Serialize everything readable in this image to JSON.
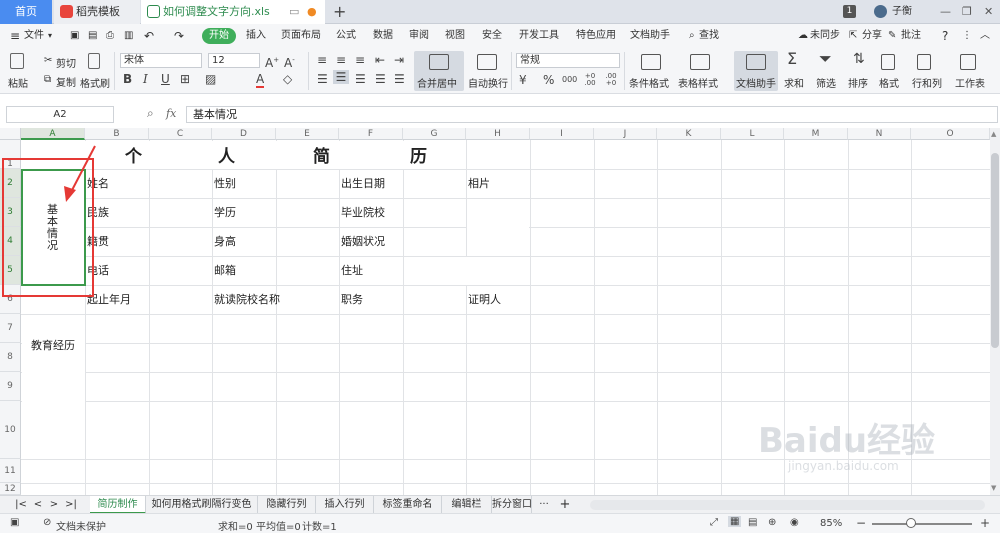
{
  "tabs": {
    "home": "首页",
    "wps": "稻壳模板",
    "file": "如何调整文字方向.xls",
    "new_tab": "+",
    "tab_count": "1",
    "user": "子衡"
  },
  "menu": {
    "file": "文件",
    "start": "开始",
    "items": [
      "插入",
      "页面布局",
      "公式",
      "数据",
      "审阅",
      "视图",
      "安全",
      "开发工具",
      "特色应用",
      "文档助手"
    ],
    "search": "查找",
    "sync": "未同步",
    "share": "分享",
    "comment": "批注"
  },
  "ribbon": {
    "paste": "粘贴",
    "cut": "剪切",
    "copy": "复制",
    "format_painter": "格式刷",
    "font_name": "宋体",
    "font_size": "12",
    "merge": "合并居中",
    "wrap": "自动换行",
    "number_format": "常规",
    "cond_format": "条件格式",
    "table_style": "表格样式",
    "doc_assist": "文档助手",
    "sum": "求和",
    "filter": "筛选",
    "sort": "排序",
    "format": "格式",
    "row_col": "行和列",
    "worksheet": "工作表",
    "bold": "B",
    "italic": "I",
    "underline": "U",
    "currency": "¥",
    "percent": "%",
    "thousands": "000",
    "dec_inc": "+0 .00",
    "dec_dec": ".00 +0"
  },
  "formula_bar": {
    "name_box": "A2",
    "fx": "fx",
    "content": "基本情况"
  },
  "columns": [
    "A",
    "B",
    "C",
    "D",
    "E",
    "F",
    "G",
    "H",
    "I",
    "J",
    "K",
    "L",
    "M",
    "N",
    "O"
  ],
  "rows": [
    "1",
    "2",
    "3",
    "4",
    "5",
    "6",
    "7",
    "8",
    "9",
    "10",
    "11",
    "12"
  ],
  "sheet": {
    "title_chars": [
      "个",
      "人",
      "简",
      "历"
    ],
    "a2": "基本情况",
    "labels": {
      "name": "姓名",
      "gender": "性别",
      "birth": "出生日期",
      "photo": "相片",
      "ethnic": "民族",
      "edu": "学历",
      "school": "毕业院校",
      "native": "籍贯",
      "height": "身高",
      "marital": "婚姻状况",
      "phone": "电话",
      "email": "邮箱",
      "address": "住址",
      "period": "起止年月",
      "school_name": "就读院校名称",
      "position": "职务",
      "witness": "证明人",
      "edu_history": "教育经历"
    }
  },
  "sheet_tabs": [
    "简历制作",
    "如何用格式刷隔行变色",
    "隐藏行列",
    "插入行列",
    "标签重命名",
    "编辑栏",
    "拆分窗口"
  ],
  "status": {
    "doc_protect": "文档未保护",
    "sum": "求和=0",
    "avg": "平均值=0",
    "count": "计数=1",
    "zoom": "85%"
  },
  "watermark": {
    "brand": "Baidu经验",
    "url": "jingyan.baidu.com"
  },
  "colors": {
    "accent_green": "#3fae5b",
    "tab_blue": "#4a8cf0",
    "annotation_red": "#e53935",
    "select_green": "#3c9a4c"
  }
}
